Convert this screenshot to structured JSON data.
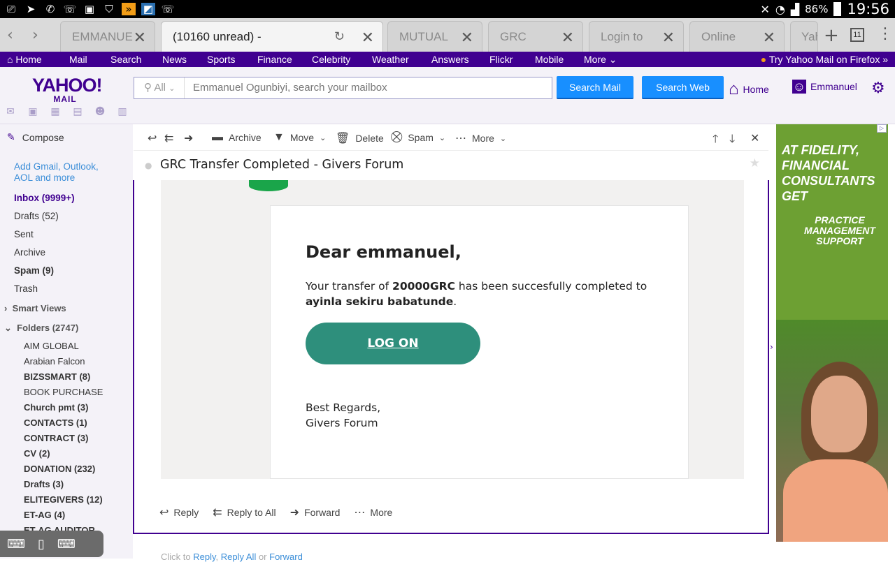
{
  "status_bar": {
    "battery": "86%",
    "time": "19:56",
    "icons": [
      "notification-icon",
      "telegram-icon",
      "whatsapp-icon",
      "phone-icon",
      "image-icon",
      "shield-icon",
      "media-icon",
      "app-icon",
      "phone-icon"
    ]
  },
  "browser": {
    "tabs": [
      {
        "label": "EMMANUE",
        "active": false
      },
      {
        "label": "(10160 unread) -",
        "active": true
      },
      {
        "label": "MUTUAL",
        "active": false
      },
      {
        "label": "GRC",
        "active": false
      },
      {
        "label": "Login to",
        "active": false
      },
      {
        "label": "Online",
        "active": false
      },
      {
        "label": "Yah",
        "active": false
      }
    ],
    "tab_count": "11"
  },
  "yahoo_nav": {
    "items": [
      "Home",
      "Mail",
      "Search",
      "News",
      "Sports",
      "Finance",
      "Celebrity",
      "Weather",
      "Answers",
      "Flickr",
      "Mobile",
      "More"
    ],
    "promo": "Try Yahoo Mail on Firefox »"
  },
  "header": {
    "logo_big": "YAHOO!",
    "logo_small": "MAIL",
    "search_scope": "All",
    "search_placeholder": "Emmanuel Ogunbiyi, search your mailbox",
    "search_mail": "Search Mail",
    "search_web": "Search Web",
    "home": "Home",
    "user": "Emmanuel"
  },
  "sidebar": {
    "compose": "Compose",
    "add_accounts": "Add Gmail, Outlook, AOL and more",
    "folders": [
      {
        "label": "Inbox (9999+)",
        "style": "inbox"
      },
      {
        "label": "Drafts (52)",
        "style": "normal"
      },
      {
        "label": "Sent",
        "style": "normal"
      },
      {
        "label": "Archive",
        "style": "normal"
      },
      {
        "label": "Spam (9)",
        "style": "bold"
      },
      {
        "label": "Trash",
        "style": "normal"
      }
    ],
    "smart_views": "Smart Views",
    "folders_header": "Folders (2747)",
    "user_folders": [
      {
        "label": "AIM GLOBAL",
        "bold": false
      },
      {
        "label": "Arabian Falcon",
        "bold": false
      },
      {
        "label": "BIZSSMART  (8)",
        "bold": true
      },
      {
        "label": "BOOK PURCHASE",
        "bold": false
      },
      {
        "label": "Church pmt  (3)",
        "bold": true
      },
      {
        "label": "CONTACTS  (1)",
        "bold": true
      },
      {
        "label": "CONTRACT  (3)",
        "bold": true
      },
      {
        "label": "CV  (2)",
        "bold": true
      },
      {
        "label": "DONATION  (232)",
        "bold": true
      },
      {
        "label": "Drafts  (3)",
        "bold": true
      },
      {
        "label": "ELITEGIVERS  (12)",
        "bold": true
      },
      {
        "label": "ET-AG  (4)",
        "bold": true
      },
      {
        "label": "ET-AG AUDITOR",
        "bold": true
      }
    ]
  },
  "toolbar": {
    "archive": "Archive",
    "move": "Move",
    "delete": "Delete",
    "spam": "Spam",
    "more": "More"
  },
  "message": {
    "subject": "GRC Transfer Completed - Givers Forum",
    "greeting": "Dear emmanuel,",
    "body_pre": "Your transfer of ",
    "amount": "20000GRC",
    "body_mid": " has been succesfully completed to ",
    "recipient": "ayinla sekiru babatunde",
    "body_end": ".",
    "button": "LOG ON",
    "regards_1": "Best Regards,",
    "regards_2": "Givers Forum"
  },
  "message_actions": {
    "reply": "Reply",
    "reply_all": "Reply to All",
    "forward": "Forward",
    "more": "More"
  },
  "quick_reply": {
    "prefix": "Click to ",
    "reply": "Reply",
    "sep1": ", ",
    "reply_all": "Reply All",
    "sep2": " or ",
    "forward": "Forward"
  },
  "ad": {
    "headline": "AT FIDELITY, FINANCIAL CONSULTANTS GET",
    "sub": "PRACTICE MANAGEMENT SUPPORT",
    "colors": {
      "bg": "#6da033"
    }
  },
  "colors": {
    "brand": "#400090",
    "button_blue": "#188fff",
    "logon_green": "#2e8f7c"
  }
}
